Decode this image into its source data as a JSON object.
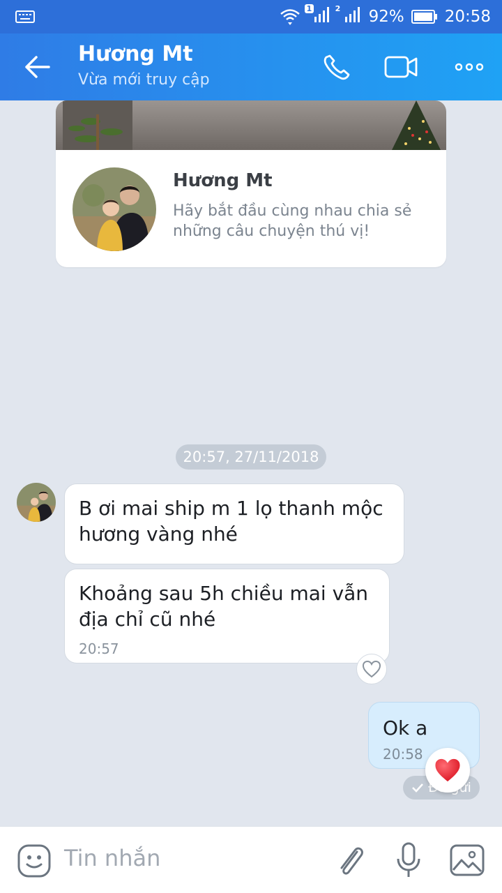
{
  "status_bar": {
    "sim1_badge": "1",
    "sim2_badge": "2",
    "battery": "92%",
    "time": "20:58"
  },
  "header": {
    "contact_name": "Hương Mt",
    "presence": "Vừa mới truy cập"
  },
  "profile_card": {
    "name": "Hương Mt",
    "description": "Hãy bắt đầu cùng nhau chia sẻ những câu chuyện thú vị!"
  },
  "conversation": {
    "date_divider": "20:57, 27/11/2018",
    "messages": [
      {
        "from": "contact",
        "text": "B ơi mai ship m 1 lọ thanh mộc hương vàng nhé"
      },
      {
        "from": "contact",
        "text": "Khoảng sau 5h chiều mai vẫn địa chỉ cũ nhé",
        "time": "20:57"
      },
      {
        "from": "me",
        "text": "Ok a",
        "time": "20:58",
        "reaction": "heart",
        "status": "Đã gửi"
      }
    ]
  },
  "composer": {
    "placeholder": "Tin nhắn"
  },
  "colors": {
    "header_gradient_start": "#2f7ce6",
    "header_gradient_end": "#1fa2f5",
    "background": "#e1e6ee",
    "outgoing_bubble": "#d7edfd",
    "heart": "#e8202f"
  }
}
